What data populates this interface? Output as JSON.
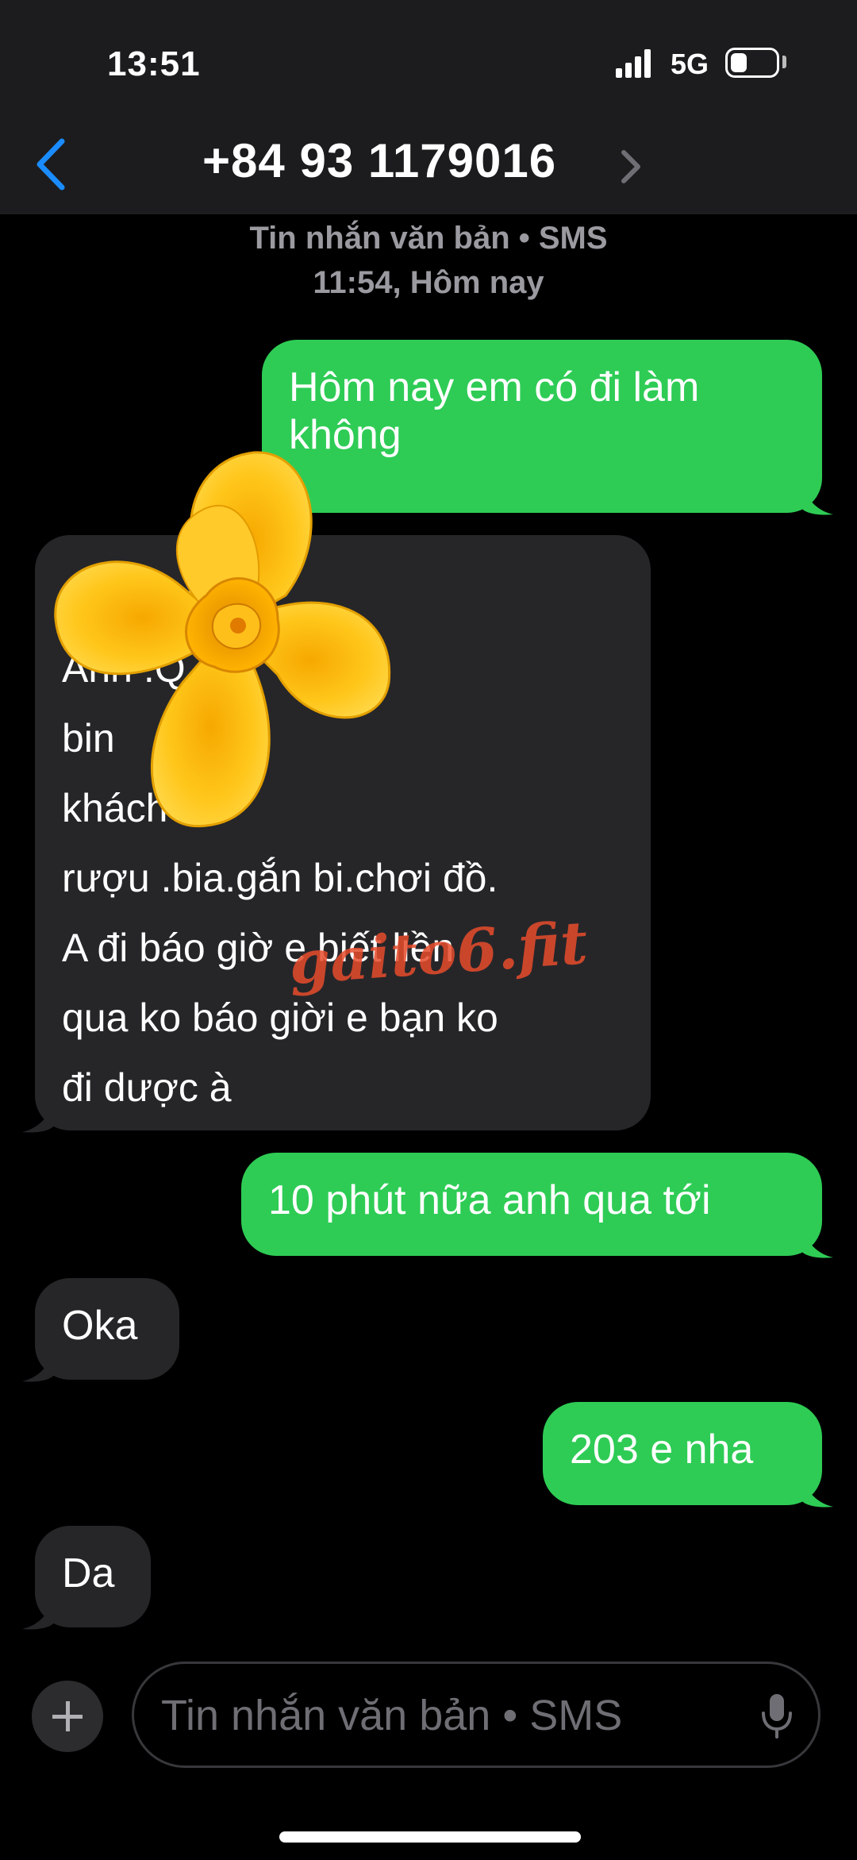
{
  "status_bar": {
    "time": "13:51",
    "network": "5G",
    "battery_level": 0.35
  },
  "header": {
    "contact": "+84 93 1179016",
    "back_icon": "chevron-left-icon",
    "details_icon": "chevron-right-icon"
  },
  "thread_meta": {
    "type": "Tin nhắn văn bản • SMS",
    "timestamp": "11:54, Hôm nay"
  },
  "messages": [
    {
      "direction": "outgoing",
      "text": "Hôm nay em có đi làm\nkhông"
    },
    {
      "direction": "incoming",
      "text": "A                         ường\n                          Anh .Q\nbin\n                          khách có\nrượu .bia.gắn bi.chơi đồ.\nA đi báo giờ e biết liền\nqua  ko báo giời e bạn ko\nđi dược à"
    },
    {
      "direction": "outgoing",
      "text": "10 phút nữa anh qua tới"
    },
    {
      "direction": "incoming",
      "text": "Oka"
    },
    {
      "direction": "outgoing",
      "text": "203 e nha"
    },
    {
      "direction": "incoming",
      "text": "Da"
    }
  ],
  "compose": {
    "placeholder": "Tin nhắn văn bản • SMS",
    "plus_icon": "plus-icon",
    "mic_icon": "microphone-icon"
  },
  "overlay": {
    "watermark": "gaito6.fit",
    "sticker": "yellow-flower"
  },
  "colors": {
    "outgoing_bubble": "#2ecc55",
    "incoming_bubble": "#262629",
    "accent": "#1a8cff",
    "watermark": "#e74c2c"
  }
}
